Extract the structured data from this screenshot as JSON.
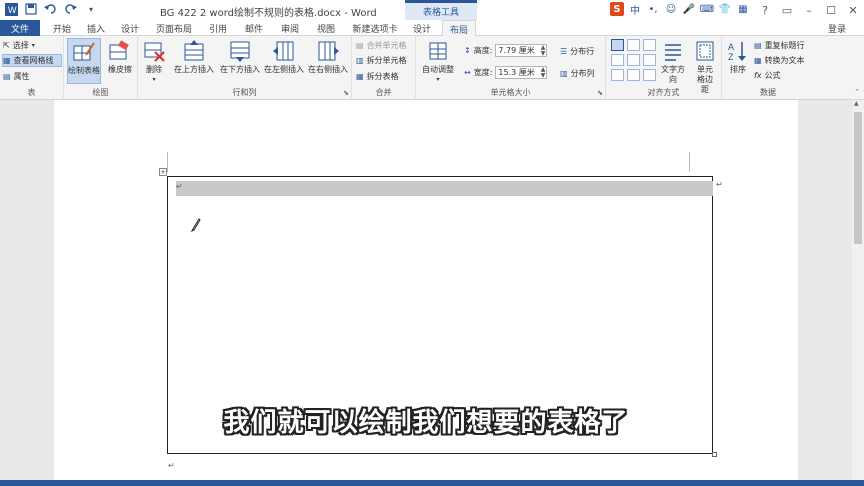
{
  "window": {
    "title": "BG 422 2 word绘制不规则的表格.docx - Word",
    "contextual_title": "表格工具"
  },
  "tabs": [
    {
      "id": "file",
      "label": "文件"
    },
    {
      "id": "home",
      "label": "开始"
    },
    {
      "id": "insert",
      "label": "插入"
    },
    {
      "id": "design",
      "label": "设计"
    },
    {
      "id": "pagelayout",
      "label": "页面布局"
    },
    {
      "id": "references",
      "label": "引用"
    },
    {
      "id": "mailings",
      "label": "邮件"
    },
    {
      "id": "review",
      "label": "审阅"
    },
    {
      "id": "view",
      "label": "视图"
    },
    {
      "id": "newtab",
      "label": "新建选项卡"
    },
    {
      "id": "tabledesign",
      "label": "设计"
    },
    {
      "id": "layout",
      "label": "布局"
    }
  ],
  "login_label": "登录",
  "ime": {
    "brand": "S",
    "lang": "中"
  },
  "ribbon": {
    "table": {
      "label": "表",
      "select": "选择",
      "gridlines": "查看网格线",
      "properties": "属性"
    },
    "draw": {
      "label": "绘图",
      "draw_table": "绘制表格",
      "eraser": "橡皮擦"
    },
    "rowscols": {
      "label": "行和列",
      "delete": "删除",
      "insert_above": "在上方插入",
      "insert_below": "在下方插入",
      "insert_left": "在左侧插入",
      "insert_right": "在右侧插入"
    },
    "merge": {
      "label": "合并",
      "merge_cells": "合并单元格",
      "split_cells": "拆分单元格",
      "split_table": "拆分表格"
    },
    "cellsize": {
      "label": "单元格大小",
      "autofit": "自动调整",
      "height_label": "高度:",
      "height_value": "7.79 厘米",
      "width_label": "宽度:",
      "width_value": "15.3 厘米",
      "distribute_rows": "分布行",
      "distribute_cols": "分布列"
    },
    "alignment": {
      "label": "对齐方式",
      "text_direction": "文字方向",
      "cell_margins": "单元格边距"
    },
    "data": {
      "label": "数据",
      "sort": "排序",
      "repeat_header": "重复标题行",
      "convert_text": "转换为文本",
      "formula": "公式"
    }
  },
  "document": {
    "paragraph_mark": "↵",
    "subtitle": "我们就可以绘制我们想要的表格了"
  },
  "colors": {
    "accent": "#2b579a",
    "row_shade": "#c9c9c9"
  }
}
